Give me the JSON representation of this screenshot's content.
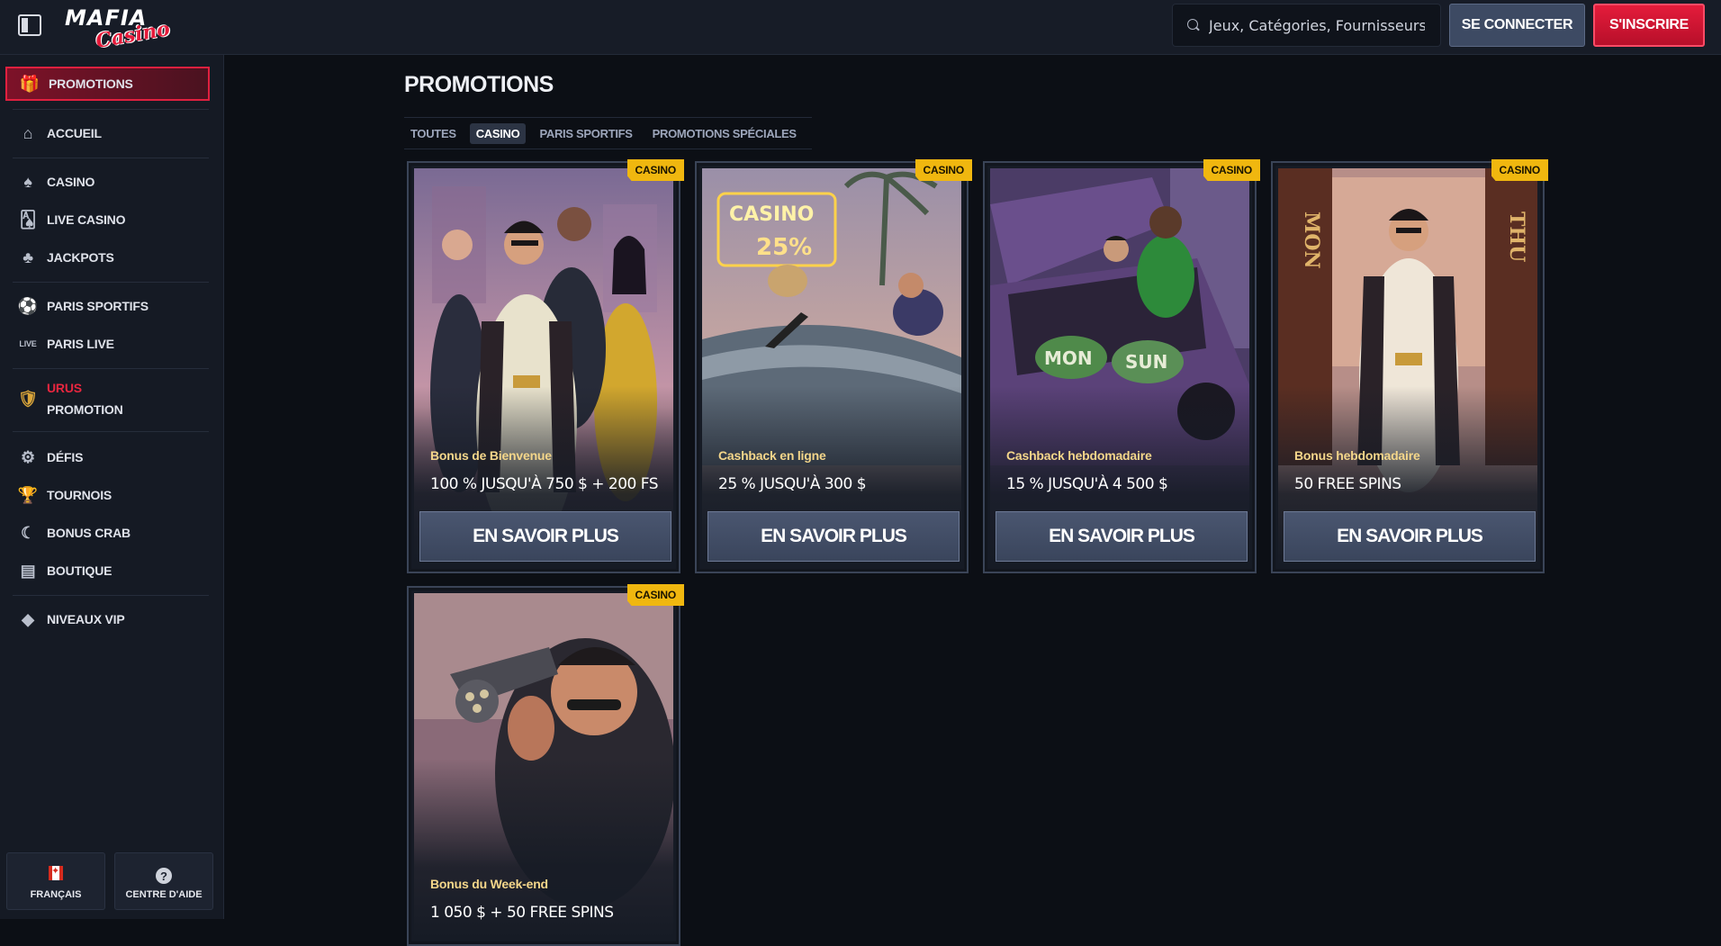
{
  "header": {
    "brand_top": "MAFIA",
    "brand_bottom": "Casino",
    "search_placeholder": "Jeux, Catégories, Fournisseurs",
    "login_label": "SE CONNECTER",
    "signup_label": "S'INSCRIRE"
  },
  "sidebar": {
    "items": [
      {
        "label": "PROMOTIONS",
        "icon": "gift-icon",
        "active": true
      },
      {
        "label": "ACCUEIL",
        "icon": "home-icon"
      },
      {
        "label": "CASINO",
        "icon": "spade-icon"
      },
      {
        "label": "LIVE CASINO",
        "icon": "cards-icon"
      },
      {
        "label": "JACKPOTS",
        "icon": "clover-icon"
      },
      {
        "label": "PARIS SPORTIFS",
        "icon": "ball-icon"
      },
      {
        "label": "PARIS LIVE",
        "icon": "live-icon"
      },
      {
        "label_line1": "URUS",
        "label_line2": "PROMOTION",
        "icon": "bull-icon"
      },
      {
        "label": "DÉFIS",
        "icon": "gear-icon"
      },
      {
        "label": "TOURNOIS",
        "icon": "trophy-icon"
      },
      {
        "label": "BONUS CRAB",
        "icon": "crab-icon"
      },
      {
        "label": "BOUTIQUE",
        "icon": "shop-icon"
      },
      {
        "label": "NIVEAUX VIP",
        "icon": "diamond-icon"
      }
    ],
    "language_label": "FRANÇAIS",
    "help_label": "CENTRE D'AIDE"
  },
  "main": {
    "title": "PROMOTIONS",
    "tabs": [
      {
        "label": "TOUTES",
        "active": false
      },
      {
        "label": "CASINO",
        "active": true
      },
      {
        "label": "PARIS SPORTIFS",
        "active": false
      },
      {
        "label": "PROMOTIONS SPÉCIALES",
        "active": false
      }
    ],
    "cards": [
      {
        "badge": "CASINO",
        "subtitle": "Bonus de Bienvenue",
        "title": "100 % JUSQU'À 750 $ + 200 FS",
        "button": "EN SAVOIR PLUS"
      },
      {
        "badge": "CASINO",
        "subtitle": "Cashback en ligne",
        "title": "25 % JUSQU'À 300 $",
        "button": "EN SAVOIR PLUS",
        "art_text_1": "CASINO",
        "art_text_2": "25%"
      },
      {
        "badge": "CASINO",
        "subtitle": "Cashback hebdomadaire",
        "title": "15 % JUSQU'À 4 500 $",
        "button": "EN SAVOIR PLUS",
        "art_text_1": "MON",
        "art_text_2": "SUN"
      },
      {
        "badge": "CASINO",
        "subtitle": "Bonus hebdomadaire",
        "title": "50 FREE SPINS",
        "button": "EN SAVOIR PLUS",
        "art_text_1": "MON",
        "art_text_2": "THU"
      },
      {
        "badge": "CASINO",
        "subtitle": "Bonus du Week-end",
        "title": "1 050 $ + 50 FREE SPINS"
      }
    ]
  },
  "colors": {
    "accent_red": "#e41c3b",
    "badge_yellow": "#f0b70f",
    "subtitle_gold": "#f4d68a",
    "button_slate": "#3d4a63"
  }
}
